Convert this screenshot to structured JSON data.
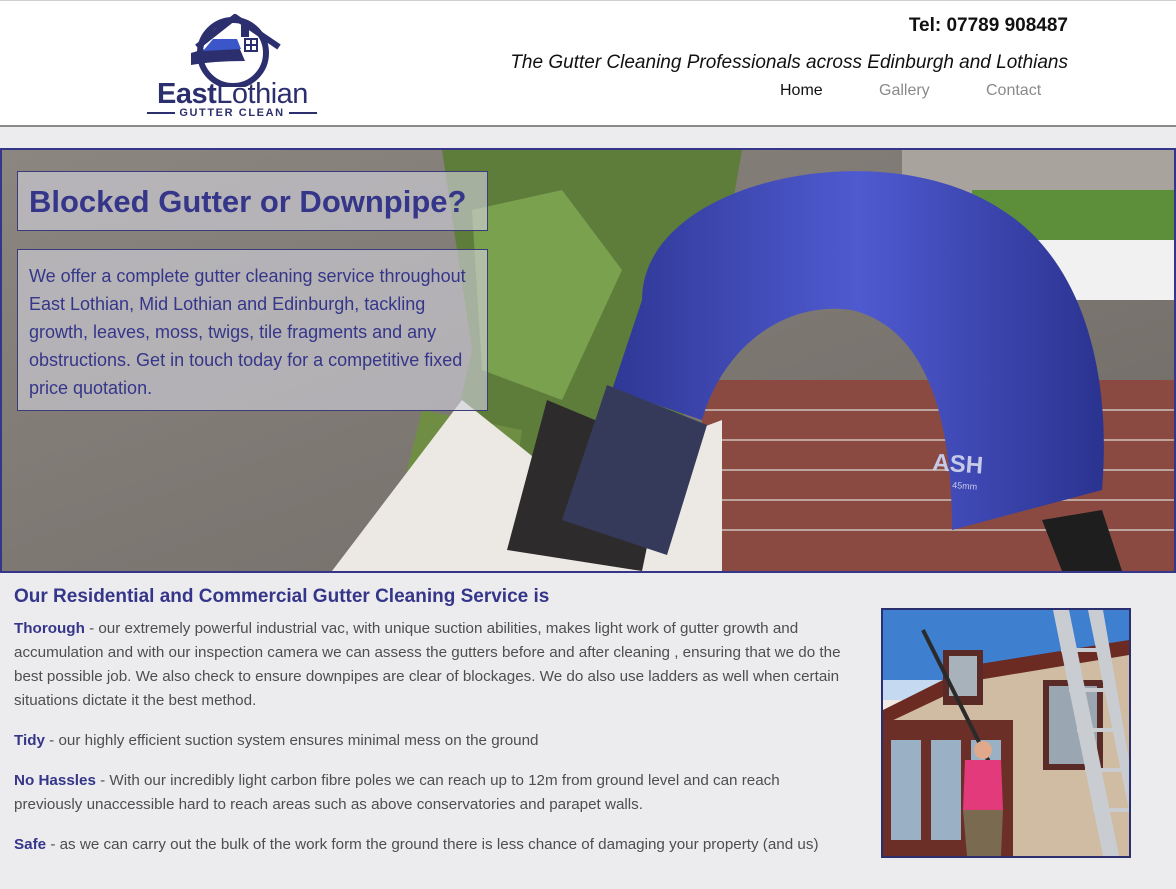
{
  "brand": {
    "name_bold": "East",
    "name_thin": "Lothian",
    "sub": "GUTTER CLEAN",
    "color": "#2c2f6e"
  },
  "header": {
    "tel": "Tel: 07789 908487",
    "tagline": "The Gutter Cleaning Professionals across Edinburgh and Lothians"
  },
  "nav": {
    "items": [
      {
        "label": "Home",
        "active": true
      },
      {
        "label": "Gallery",
        "active": false
      },
      {
        "label": "Contact",
        "active": false
      }
    ]
  },
  "hero": {
    "title": "Blocked Gutter or Downpipe?",
    "text": "We offer a complete gutter cleaning service throughout East Lothian, Mid Lothian and Edinburgh, tackling growth, leaves, moss, twigs, tile fragments and any obstructions. Get in touch today for a competitive fixed price quotation.",
    "hose_brand": "ASH",
    "hose_size": "45mm"
  },
  "services": {
    "heading": "Our Residential and Commercial Gutter Cleaning Service is",
    "items": [
      {
        "term": "Thorough",
        "text": " - our extremely powerful industrial vac, with unique suction abilities,  makes light work of gutter growth and accumulation and with our inspection camera we can assess the gutters before and after cleaning , ensuring that we do the best possible job.  We also check to ensure downpipes are clear of blockages. We do also use ladders as well when certain situations dictate it the best method."
      },
      {
        "term": "Tidy",
        "text": " - our highly efficient suction system ensures minimal mess on the ground"
      },
      {
        "term": "No Hassles",
        "text": " - With our incredibly light carbon fibre poles we can reach up to 12m from ground level and can reach previously unaccessible hard to reach areas such as above conservatories and parapet walls."
      },
      {
        "term": "Safe",
        "text": " - as we can carry out the bulk of the work form the ground there is less chance of damaging your property (and us)"
      }
    ]
  },
  "colors": {
    "accent": "#35368a",
    "page_bg": "#ececee",
    "hose": "#3f48b5"
  }
}
